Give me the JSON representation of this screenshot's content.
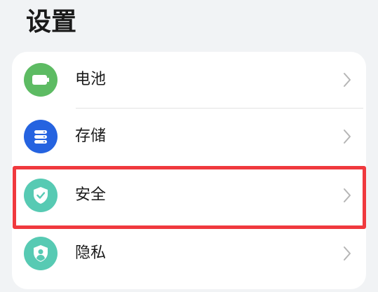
{
  "header": {
    "title": "设置"
  },
  "settings": {
    "items": [
      {
        "label": "电池",
        "icon": "battery-icon",
        "color": "#5dbb63"
      },
      {
        "label": "存储",
        "icon": "storage-icon",
        "color": "#2563e0"
      },
      {
        "label": "安全",
        "icon": "shield-icon",
        "color": "#57cab3"
      },
      {
        "label": "隐私",
        "icon": "privacy-user-icon",
        "color": "#57cab3"
      }
    ]
  },
  "colors": {
    "background": "#f1f3f5",
    "card": "#ffffff",
    "highlight": "#f0393e"
  }
}
